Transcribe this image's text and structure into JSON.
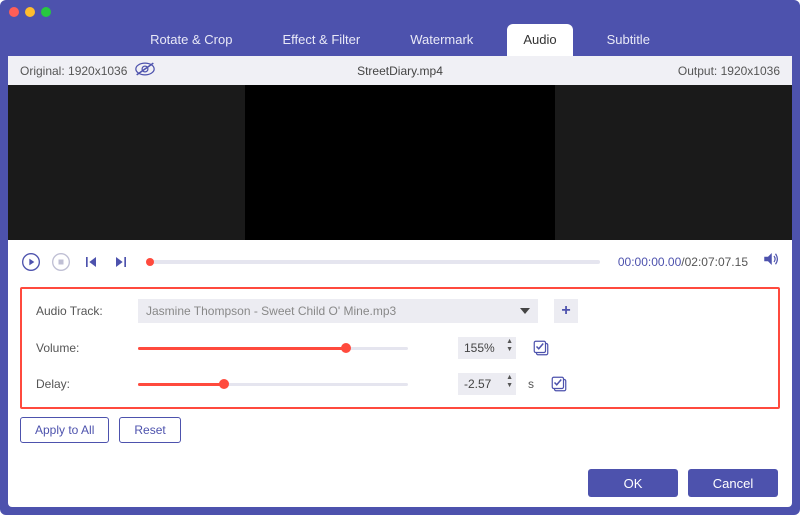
{
  "tabs": {
    "rotate": "Rotate & Crop",
    "effect": "Effect & Filter",
    "watermark": "Watermark",
    "audio": "Audio",
    "subtitle": "Subtitle"
  },
  "videoHeader": {
    "original": "Original: 1920x1036",
    "filename": "StreetDiary.mp4",
    "output": "Output: 1920x1036"
  },
  "transport": {
    "elapsed": "00:00:00.00",
    "duration": "/02:07:07.15"
  },
  "audio": {
    "trackLabel": "Audio Track:",
    "trackValue": "Jasmine Thompson - Sweet Child O' Mine.mp3",
    "volumeLabel": "Volume:",
    "volumeValue": "155%",
    "volumePercent": 77,
    "delayLabel": "Delay:",
    "delayValue": "-2.57",
    "delayUnit": "s",
    "delayPercent": 32
  },
  "buttons": {
    "applyAll": "Apply to All",
    "reset": "Reset",
    "ok": "OK",
    "cancel": "Cancel"
  },
  "colors": {
    "primary": "#4d52ad",
    "accent": "#ff4a3d"
  }
}
